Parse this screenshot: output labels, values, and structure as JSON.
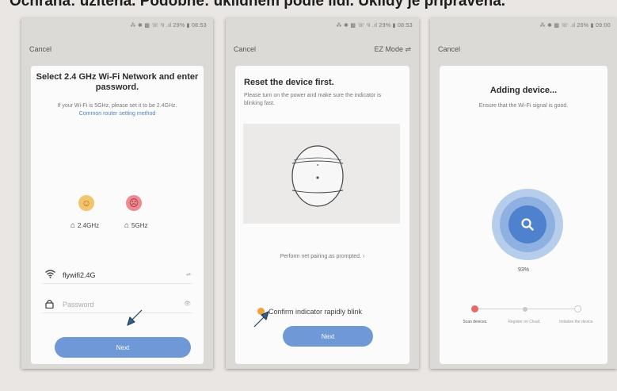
{
  "caption": "Ochrana: uzitena. Podobne: uklidnem podle lidi. Uklidy je pripravena.",
  "screen1": {
    "status": "⁂ ✱ ▩ ☏ ᵗᵍ .ıl 29% ▮ 08:53",
    "nav_left": "Cancel",
    "title": "Select 2.4 GHz Wi-Fi Network and enter password.",
    "note": "If your Wi-Fi is 5GHz, please set it to be 2.4GHz.",
    "note_link": "Common router setting method",
    "band_24": "2.4GHz",
    "band_5": "5GHz",
    "wifi_name": "flywifi2.4G",
    "wifi_trail": "⇌",
    "password_placeholder": "Password",
    "password_trail": "👁",
    "next_label": "Next"
  },
  "screen2": {
    "status": "⁂ ✱ ▩ ☏ ᵗᵍ .ıl 29% ▮ 08:53",
    "nav_left": "Cancel",
    "nav_right": "EZ Mode ⇌",
    "title": "Reset the device first.",
    "note": "Please turn on the power and make sure the indicator is blinking fast.",
    "prompt": "Perform net pairing as prompted. ›",
    "confirm": "Confirm indicator rapidly blink",
    "next_label": "Next"
  },
  "screen3": {
    "status": "⁂ ✱ ▩ ☏ .ıl 26% ▮ 09:00",
    "nav_left": "Cancel",
    "title": "Adding device...",
    "note": "Ensure that the Wi-Fi signal is good.",
    "progress_value": 93,
    "progress_label": "93%",
    "steps": [
      "Scan devices.",
      "Register on Cloud.",
      "Initialize the device."
    ]
  },
  "colors": {
    "accent_blue": "#6f98d6",
    "progress_blue": "#4e82cf",
    "indicator_orange": "#f0a13a",
    "step_active": "#e36a6a"
  }
}
